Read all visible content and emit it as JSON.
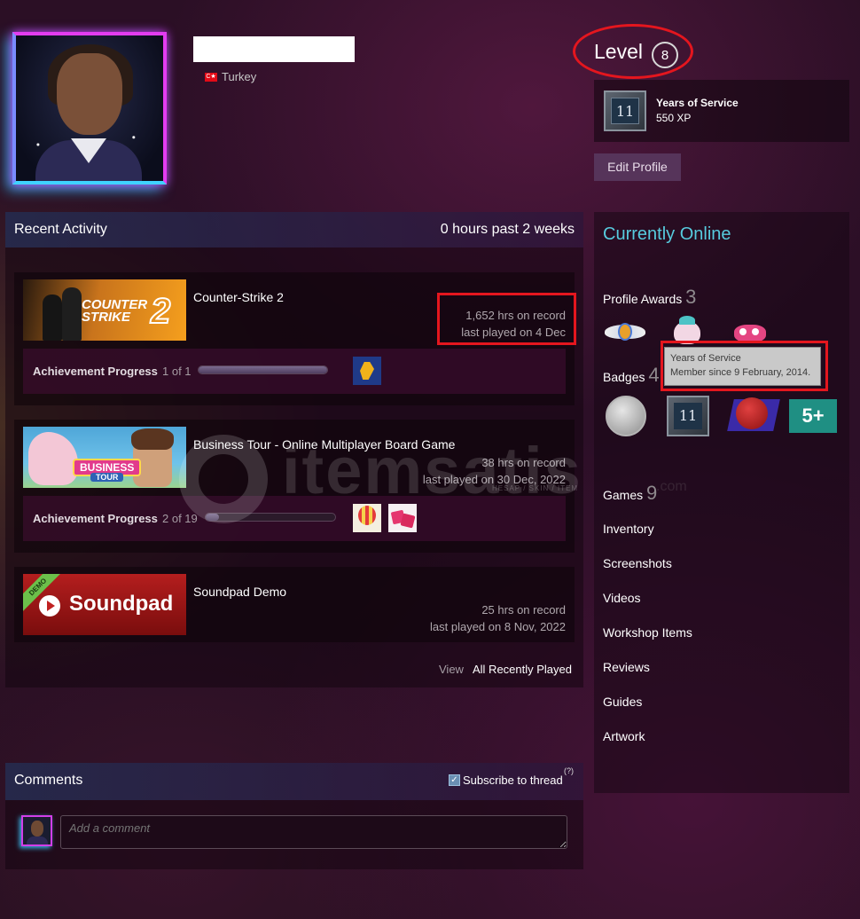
{
  "profile": {
    "country": "Turkey",
    "flag_text": "C★",
    "level_label": "Level",
    "level": "8"
  },
  "xp_badge": {
    "number": "11",
    "title": "Years of Service",
    "xp": "550 XP"
  },
  "edit_profile_label": "Edit Profile",
  "recent_activity": {
    "title": "Recent Activity",
    "hours": "0 hours past 2 weeks",
    "games": [
      {
        "name": "Counter-Strike 2",
        "hours": "1,652 hrs on record",
        "last_played": "last played on 4 Dec",
        "banner_text": "COUNTER STRIKE",
        "banner_num": "2",
        "achievement_label": "Achievement Progress",
        "achievement_count": "1 of 1",
        "achievement_progress": 1.0
      },
      {
        "name": "Business Tour - Online Multiplayer Board Game",
        "hours": "38 hrs on record",
        "last_played": "last played on 30 Dec, 2022",
        "banner_text": "BUSINESS",
        "banner_sub": "TOUR",
        "achievement_label": "Achievement Progress",
        "achievement_count": "2 of 19",
        "achievement_progress": 0.105
      },
      {
        "name": "Soundpad Demo",
        "hours": "25 hrs on record",
        "last_played": "last played on 8 Nov, 2022",
        "banner_text": "Soundpad",
        "banner_tag": "DEMO"
      }
    ],
    "view_label": "View",
    "view_all_label": "All Recently Played"
  },
  "watermark": {
    "text": "itemsatis",
    "sub": "HESAP / SKIN / ITEM",
    "domain": ".com"
  },
  "sidebar": {
    "online_status": "Currently Online",
    "profile_awards_label": "Profile Awards",
    "profile_awards_count": "3",
    "badges_label": "Badges",
    "badges_count": "4",
    "badge_numbers": [
      "11",
      "5+"
    ],
    "games_label": "Games",
    "games_count": "9",
    "links": [
      "Inventory",
      "Screenshots",
      "Videos",
      "Workshop Items",
      "Reviews",
      "Guides",
      "Artwork"
    ]
  },
  "tooltip": {
    "title": "Years of Service",
    "detail": "Member since 9 February, 2014."
  },
  "comments": {
    "title": "Comments",
    "subscribe_label": "Subscribe to thread",
    "help": "(?)",
    "placeholder": "Add a comment",
    "check": "✓"
  },
  "colors": {
    "accent_online": "#57cbde",
    "highlight_red": "#e4161e",
    "edit_button": "#56345a"
  }
}
